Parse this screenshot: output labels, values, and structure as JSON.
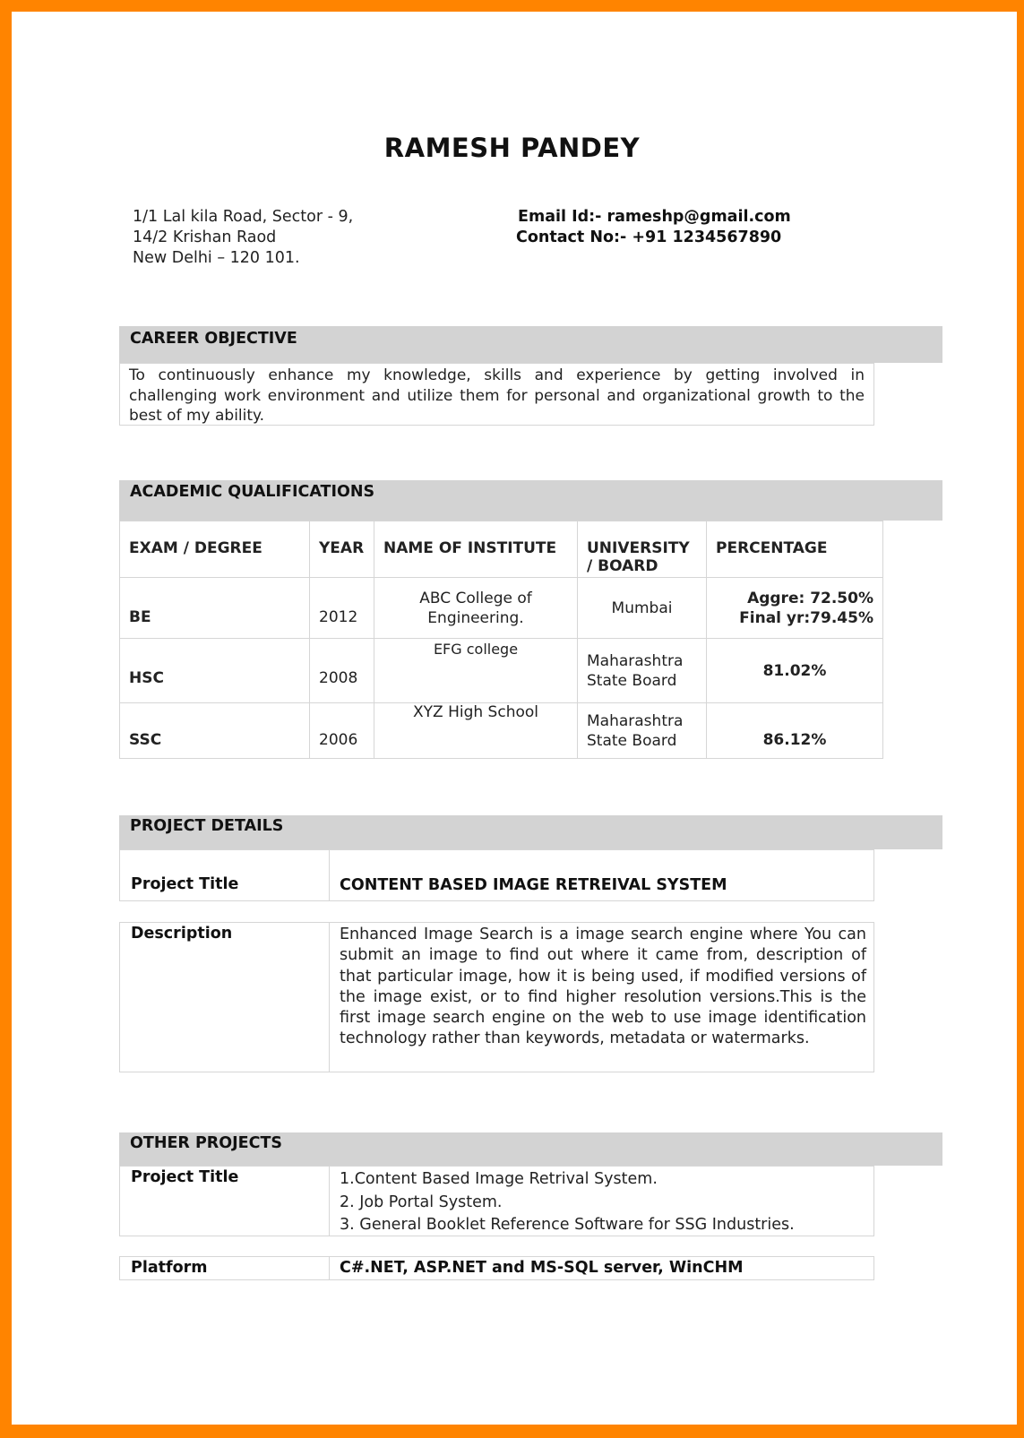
{
  "resume": {
    "name": "RAMESH PANDEY",
    "address": {
      "line1": "1/1 Lal kila Road, Sector - 9,",
      "line2": "14/2 Krishan Raod",
      "line3": "New Delhi – 120 101."
    },
    "contact": {
      "email": "Email Id:- rameshp@gmail.com",
      "phone": "Contact No:- +91 1234567890"
    }
  },
  "career_objective": {
    "heading": "CAREER OBJECTIVE",
    "text": "To continuously enhance my knowledge, skills and experience by getting involved in challenging work environment and utilize them for personal and organizational growth to the best of my ability."
  },
  "academic": {
    "heading": "ACADEMIC QUALIFICATIONS",
    "columns": [
      "EXAM / DEGREE",
      "YEAR",
      "NAME OF INSTITUTE",
      "UNIVERSITY / BOARD",
      "PERCENTAGE"
    ],
    "rows": [
      {
        "exam": "BE",
        "year": "2012",
        "institute": "ABC College of Engineering.",
        "board": "Mumbai",
        "percentage_line1": "Aggre: 72.50%",
        "percentage_line2": "Final yr:79.45%"
      },
      {
        "exam": "HSC",
        "year": "2008",
        "institute": "EFG college",
        "board": "Maharashtra State Board",
        "percentage_line1": "81.02%"
      },
      {
        "exam": "SSC",
        "year": "2006",
        "institute": "XYZ High School",
        "board": "Maharashtra State Board",
        "percentage_line1": "86.12%"
      }
    ]
  },
  "project_details": {
    "heading": "PROJECT DETAILS",
    "title_label": "Project Title",
    "title_value": "CONTENT BASED IMAGE RETREIVAL SYSTEM",
    "description_label": "Description",
    "description_value": "Enhanced Image Search  is a  image search engine where You can submit an image to find out where it came from, description of that particular image, how it is being used, if modified versions of the image exist, or to find higher resolution versions.This is the first image search engine on the web to use image identification technology rather than keywords, metadata or watermarks."
  },
  "other_projects": {
    "heading": "OTHER PROJECTS",
    "title_label": "Project Title",
    "items": [
      "1.Content Based Image Retrival System.",
      "2. Job Portal System.",
      "3. General Booklet Reference Software for SSG Industries."
    ],
    "platform_label": "Platform",
    "platform_value": "C#.NET, ASP.NET and MS-SQL server, WinCHM"
  },
  "colors": {
    "frame": "#ff8400",
    "section_header": "#d3d3d3"
  }
}
